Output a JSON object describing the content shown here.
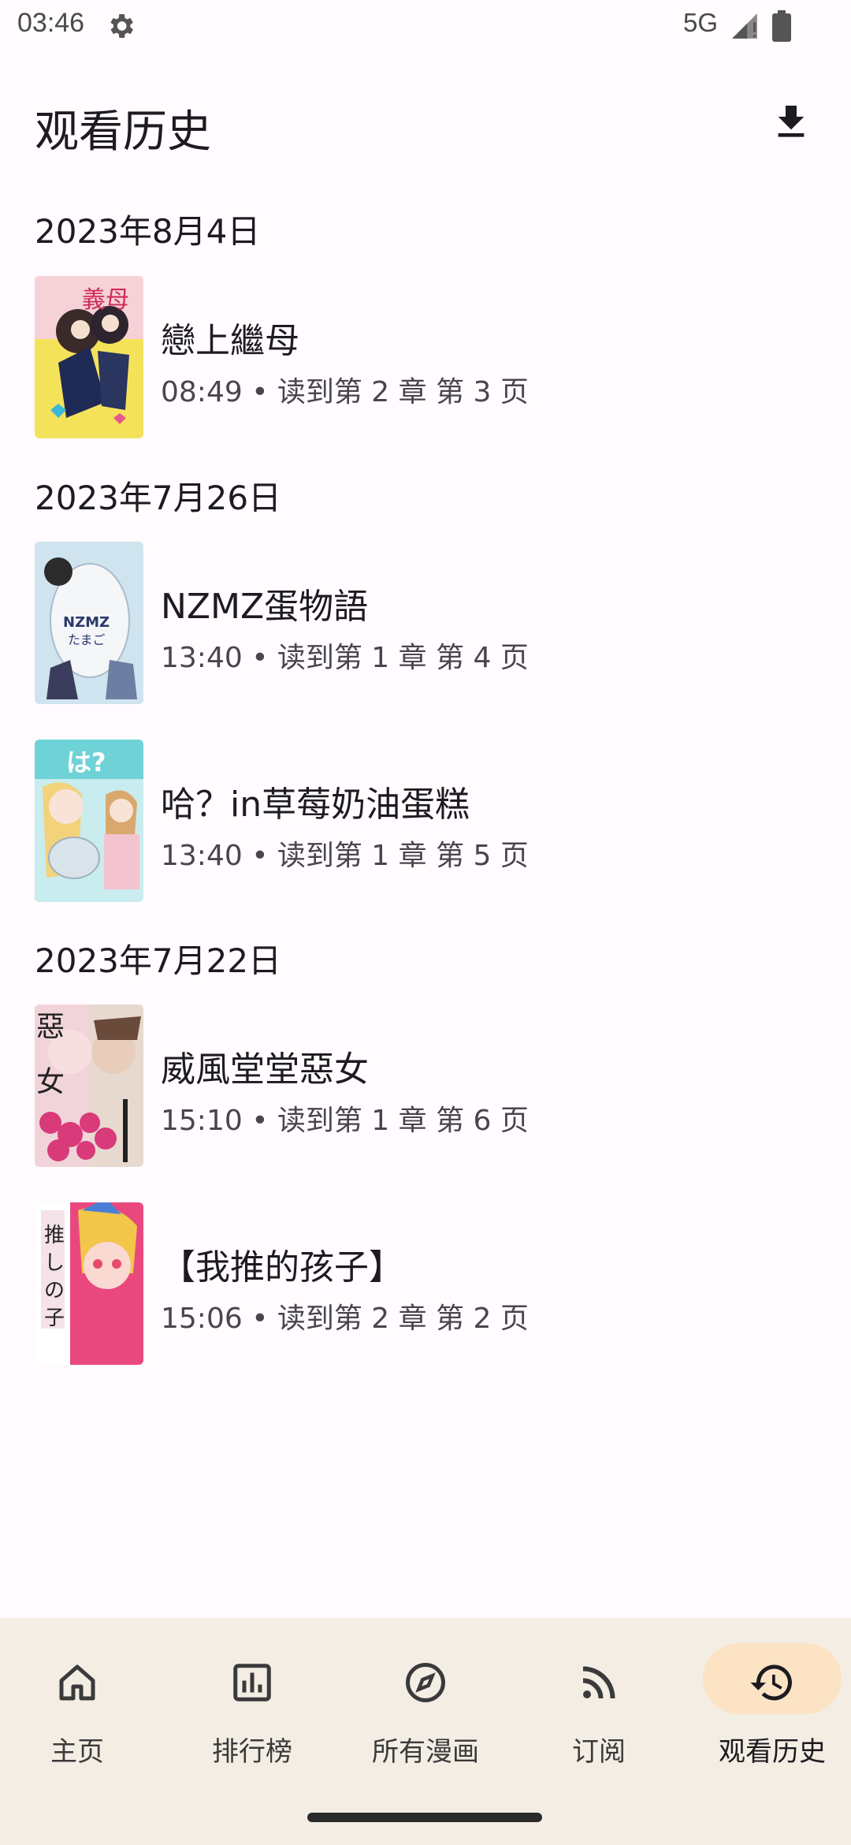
{
  "status_bar": {
    "time": "03:46",
    "network": "5G"
  },
  "header": {
    "title": "观看历史",
    "download_icon": "download-icon"
  },
  "sections": [
    {
      "date": "2023年8月4日",
      "items": [
        {
          "title": "戀上繼母",
          "meta": "08:49 • 读到第 2 章 第 3 页"
        }
      ]
    },
    {
      "date": "2023年7月26日",
      "items": [
        {
          "title": "NZMZ蛋物語",
          "meta": "13:40 • 读到第 1 章 第 4 页"
        },
        {
          "title": "哈？in草莓奶油蛋糕",
          "meta": "13:40 • 读到第 1 章 第 5 页"
        }
      ]
    },
    {
      "date": "2023年7月22日",
      "items": [
        {
          "title": "威風堂堂惡女",
          "meta": "15:10 • 读到第 1 章 第 6 页"
        },
        {
          "title": "【我推的孩子】",
          "meta": "15:06 • 读到第 2 章 第 2 页"
        }
      ]
    }
  ],
  "bottom_nav": [
    {
      "label": "主页",
      "icon": "home-icon"
    },
    {
      "label": "排行榜",
      "icon": "chart-icon"
    },
    {
      "label": "所有漫画",
      "icon": "compass-icon"
    },
    {
      "label": "订阅",
      "icon": "rss-icon"
    },
    {
      "label": "观看历史",
      "icon": "history-icon",
      "active": true
    }
  ],
  "colors": {
    "background": "#fffbfe",
    "nav_background": "#f3ede4",
    "active_pill": "#fbe3c4"
  }
}
